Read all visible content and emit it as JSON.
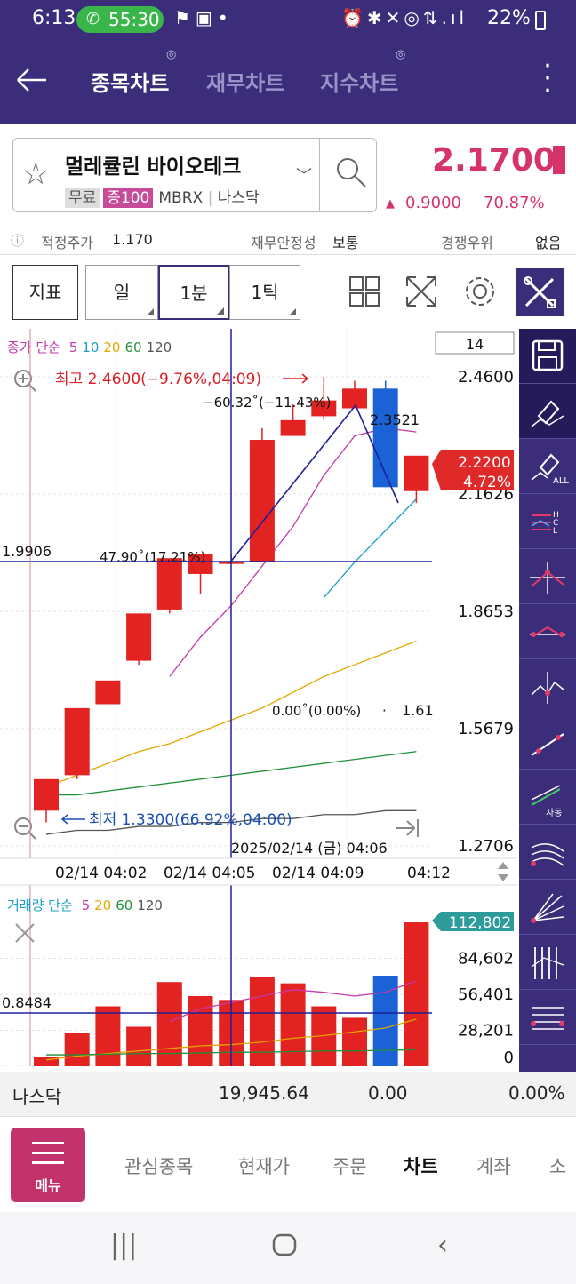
{
  "status": {
    "time": "6:13",
    "call": "55:30",
    "battery": "22%"
  },
  "header": {
    "tabs": [
      {
        "label": "종목차트",
        "active": true
      },
      {
        "label": "재무차트",
        "active": false
      },
      {
        "label": "지수차트",
        "active": false
      }
    ]
  },
  "stock": {
    "name": "멀레큘린 바이오테크",
    "tags": [
      "무료",
      "증100"
    ],
    "ticker": "MBRX",
    "market": "나스닥",
    "price": "2.1700",
    "change": "0.9000",
    "change_pct": "70.87%"
  },
  "info": {
    "fair_label": "적정주가",
    "fair_value": "1.170",
    "fin_label": "재무안정성",
    "fin_value": "보통",
    "comp_label": "경쟁우위",
    "comp_value": "없음"
  },
  "toolbar": {
    "indicator": "지표",
    "periods": [
      {
        "label": "일",
        "selected": false
      },
      {
        "label": "1분",
        "selected": true
      },
      {
        "label": "1틱",
        "selected": false
      }
    ]
  },
  "chart_data": {
    "type": "candlestick",
    "legend_prefix": "종가 단순",
    "ma_periods": [
      "5",
      "10",
      "20",
      "60",
      "120"
    ],
    "ma_colors": [
      "#c23aa8",
      "#1a9fc9",
      "#e0a800",
      "#1e8f3a",
      "#555555"
    ],
    "count_box": "14",
    "y_ticks": [
      "2.4600",
      "2.1626",
      "1.8653",
      "1.5679",
      "1.2706"
    ],
    "ylim": [
      1.2706,
      2.46
    ],
    "x_ticks": [
      "02/14 04:02",
      "02/14 04:05",
      "02/14 04:09",
      "04:12"
    ],
    "cursor_label": "2025/02/14 (금) 04:06",
    "current_price": "2.2200",
    "current_pct": "4.72%",
    "high_label": "최고 2.4600(−9.76%,04:09)",
    "low_label": "최저 1.3300(66.92%,04:00)",
    "crosshair_value": "1.9906",
    "annotations": {
      "angle1": "−60.32˚(−11.43%)",
      "price1": "2.3521",
      "angle2": "47.90˚(17.21%)",
      "angle3": "0.00˚(0.00%)",
      "price3": "1.61"
    },
    "candles": [
      {
        "o": 1.36,
        "h": 1.37,
        "l": 1.33,
        "c": 1.44
      },
      {
        "o": 1.45,
        "h": 1.58,
        "l": 1.44,
        "c": 1.62
      },
      {
        "o": 1.63,
        "h": 1.69,
        "l": 1.63,
        "c": 1.69
      },
      {
        "o": 1.74,
        "h": 1.77,
        "l": 1.73,
        "c": 1.86
      },
      {
        "o": 1.87,
        "h": 1.99,
        "l": 1.86,
        "c": 2.0
      },
      {
        "o": 1.96,
        "h": 2.01,
        "l": 1.91,
        "c": 2.01
      },
      {
        "o": 1.99,
        "h": 2.01,
        "l": 1.99,
        "c": 1.99
      },
      {
        "o": 1.99,
        "h": 2.33,
        "l": 1.99,
        "c": 2.3
      },
      {
        "o": 2.31,
        "h": 2.39,
        "l": 2.31,
        "c": 2.35
      },
      {
        "o": 2.36,
        "h": 2.46,
        "l": 2.35,
        "c": 2.4
      },
      {
        "o": 2.38,
        "h": 2.45,
        "l": 2.38,
        "c": 2.43
      },
      {
        "o": 2.43,
        "h": 2.45,
        "l": 2.18,
        "c": 2.18
      },
      {
        "o": 2.17,
        "h": 2.26,
        "l": 2.14,
        "c": 2.26
      }
    ],
    "ma5": [
      null,
      null,
      null,
      null,
      1.7,
      1.8,
      1.88,
      1.98,
      2.08,
      2.21,
      2.31,
      2.33,
      2.32
    ],
    "ma10": [
      null,
      null,
      null,
      null,
      null,
      null,
      null,
      null,
      null,
      1.9,
      1.99,
      2.07,
      2.15
    ],
    "ma20": [
      1.42,
      1.45,
      1.48,
      1.51,
      1.53,
      1.56,
      1.59,
      1.62,
      1.66,
      1.7,
      1.73,
      1.76,
      1.79
    ],
    "ma60": [
      1.4,
      1.4,
      1.41,
      1.42,
      1.43,
      1.44,
      1.45,
      1.46,
      1.47,
      1.48,
      1.49,
      1.5,
      1.51
    ],
    "ma120": [
      1.3,
      1.31,
      1.31,
      1.32,
      1.32,
      1.33,
      1.33,
      1.34,
      1.34,
      1.35,
      1.35,
      1.36,
      1.36
    ],
    "volume_legend_prefix": "거래량 단순",
    "vol_ma_periods": [
      "5",
      "20",
      "60",
      "120"
    ],
    "vol_ma_colors": [
      "#c23aa8",
      "#e0a800",
      "#1e8f3a",
      "#555555"
    ],
    "volume_ticks": [
      "84,602",
      "56,401",
      "28,201",
      "0"
    ],
    "volume_current": "112,802",
    "volume_crosshair": "0.8484",
    "volume_max": 112802,
    "volumes": [
      7000,
      26000,
      47000,
      31000,
      66000,
      55000,
      52000,
      70000,
      65000,
      47000,
      38000,
      71000,
      112802
    ],
    "vol_ma5": [
      null,
      null,
      null,
      null,
      35000,
      45000,
      50000,
      55000,
      60000,
      58000,
      55000,
      58000,
      67000
    ],
    "vol_ma20": [
      5000,
      8000,
      10000,
      12000,
      14000,
      16000,
      17000,
      19000,
      22000,
      24000,
      27000,
      30000,
      37000
    ],
    "vol_ma60": [
      9000,
      9000,
      9500,
      10000,
      10000,
      10500,
      11000,
      11000,
      11500,
      12000,
      12000,
      12500,
      13000
    ]
  },
  "right_toolbar": [
    "save-icon",
    "eraser-icon",
    "eraser-all-icon",
    "hcl-icon",
    "cross-line-icon",
    "peak-line-icon",
    "valley-line-icon",
    "trend-line-icon",
    "auto-trend-icon",
    "fan-arc-icon",
    "fan-line-icon",
    "vertical-lines-icon",
    "horizontal-lines-icon"
  ],
  "index": {
    "name": "나스닥",
    "value": "19,945.64",
    "change": "0.00",
    "pct": "0.00%"
  },
  "nav": {
    "menu_label": "메뉴",
    "items": [
      {
        "label": "관심종목",
        "active": false
      },
      {
        "label": "현재가",
        "active": false
      },
      {
        "label": "주문",
        "active": false
      },
      {
        "label": "차트",
        "active": true
      },
      {
        "label": "계좌",
        "active": false
      },
      {
        "label": "소",
        "active": false
      }
    ]
  }
}
